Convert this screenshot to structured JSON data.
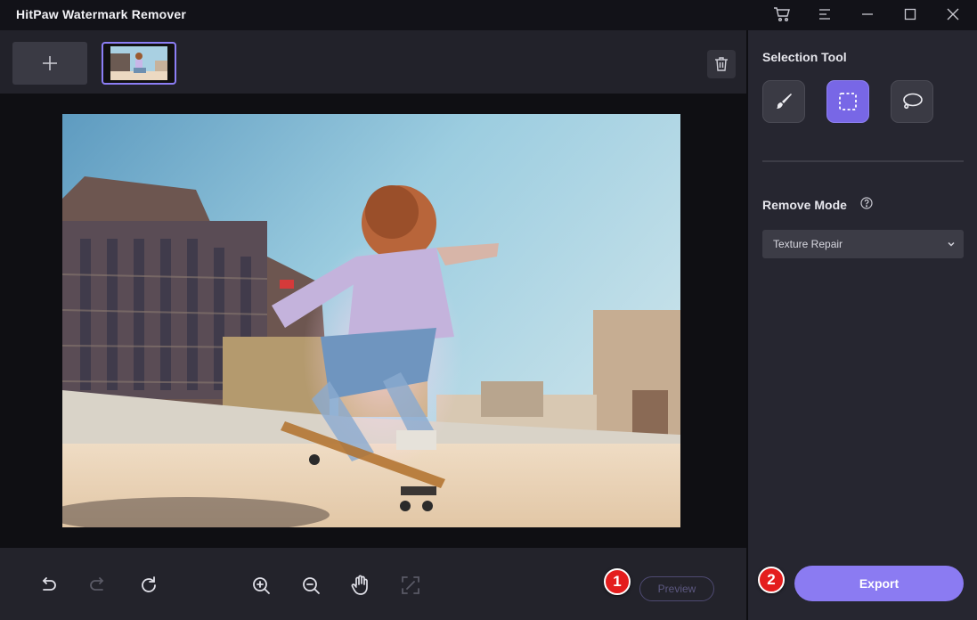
{
  "app": {
    "title": "HitPaw Watermark Remover"
  },
  "window_controls": [
    "cart-icon",
    "menu-icon",
    "minimize-icon",
    "maximize-icon",
    "close-icon"
  ],
  "panel": {
    "selection_tool": {
      "title": "Selection Tool",
      "tools": [
        {
          "name": "brush-tool",
          "icon": "brush-icon",
          "active": false
        },
        {
          "name": "rectangle-tool",
          "icon": "marquee-icon",
          "active": true
        },
        {
          "name": "lasso-tool",
          "icon": "lasso-icon",
          "active": false
        }
      ]
    },
    "remove_mode": {
      "title": "Remove Mode",
      "selected": "Texture Repair"
    },
    "export_label": "Export"
  },
  "bottom_bar": {
    "tools": [
      "undo-icon",
      "redo-icon",
      "reset-icon",
      "zoom-in-icon",
      "zoom-out-icon",
      "hand-icon",
      "fit-screen-icon"
    ],
    "preview_label": "Preview"
  },
  "annotations": {
    "badge_1": "1",
    "badge_2": "2"
  },
  "colors": {
    "accent": "#8b7bf2",
    "active_tool": "#7867e6",
    "thumb_border": "#8c7ef5",
    "badge_red": "#e41d1d"
  }
}
